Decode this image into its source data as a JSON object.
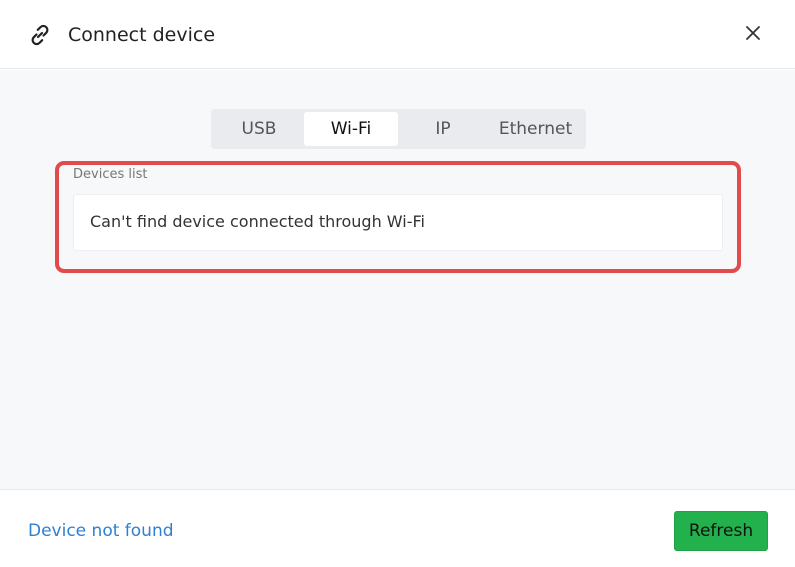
{
  "dialog": {
    "title": "Connect device"
  },
  "tabs": [
    {
      "label": "USB",
      "active": false
    },
    {
      "label": "Wi-Fi",
      "active": true
    },
    {
      "label": "IP",
      "active": false
    },
    {
      "label": "Ethernet",
      "active": false
    }
  ],
  "devices": {
    "label": "Devices list",
    "empty_message": "Can't find device connected through Wi-Fi"
  },
  "footer": {
    "not_found_link": "Device not found",
    "refresh_label": "Refresh"
  },
  "colors": {
    "accent_green": "#22b14c",
    "link_blue": "#2f7fd3",
    "highlight_red": "#e24b4b"
  }
}
